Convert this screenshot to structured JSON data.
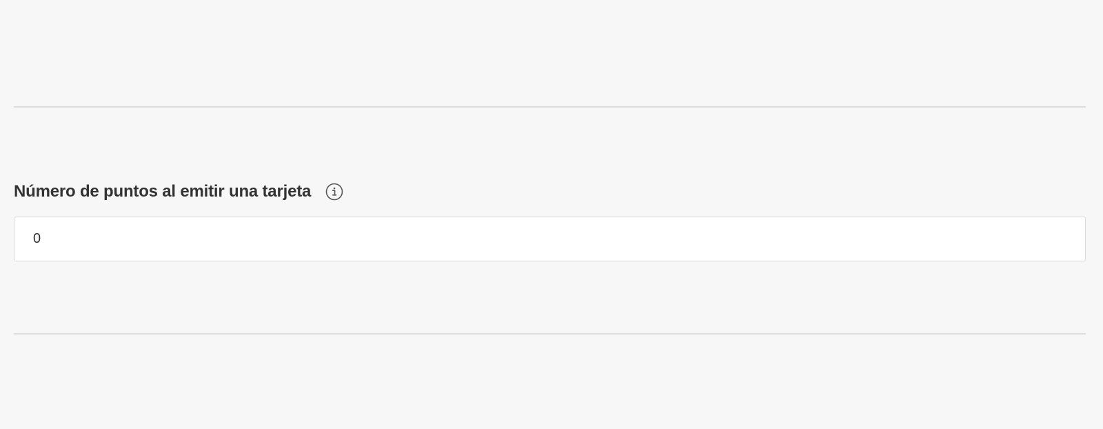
{
  "form": {
    "points_field": {
      "label": "Número de puntos al emitir una tarjeta",
      "value": "0",
      "info_icon": "info-circle-icon"
    }
  },
  "colors": {
    "background": "#f7f7f7",
    "divider": "#dddddd",
    "input_border": "#d9d9d9",
    "text": "#333333",
    "icon": "#555555"
  }
}
